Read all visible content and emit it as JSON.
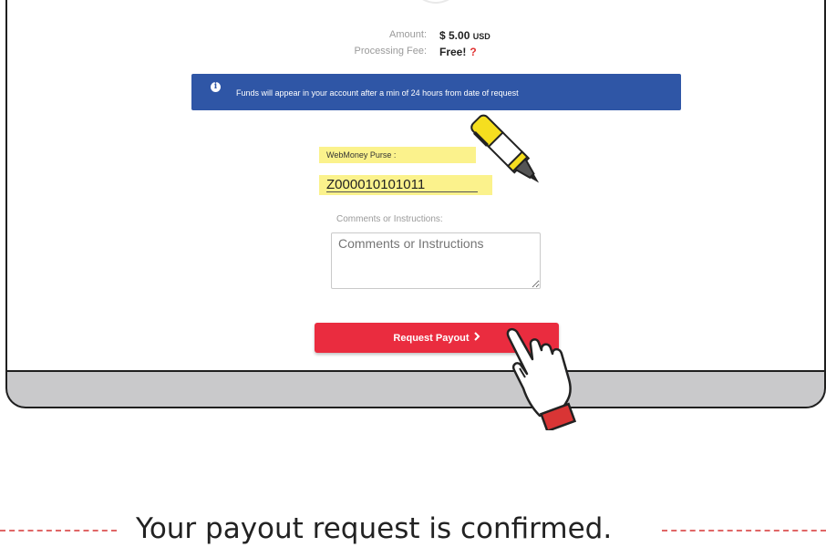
{
  "amount": {
    "label": "Amount:",
    "value": "$ 5.00",
    "currency": "USD"
  },
  "fee": {
    "label": "Processing Fee:",
    "value": "Free!",
    "help": "?"
  },
  "notice": {
    "icon": "info-icon",
    "text": "Funds will appear in your account after a min of 24 hours from date of request",
    "bg": "#2f56a6"
  },
  "purse": {
    "label": "WebMoney Purse :",
    "value": "Z000010101011",
    "highlight": "#fbf28c"
  },
  "comments": {
    "label": "Comments or Instructions:",
    "placeholder": "Comments or Instructions"
  },
  "payout_button": {
    "label": "Request Payout",
    "icon": "chevron-right-icon",
    "color": "#ea2c3f"
  },
  "caption": {
    "text": "Your payout request is confirmed."
  },
  "illustrations": {
    "pen": "highlighter-pen-icon",
    "hand": "pointing-hand-icon"
  }
}
